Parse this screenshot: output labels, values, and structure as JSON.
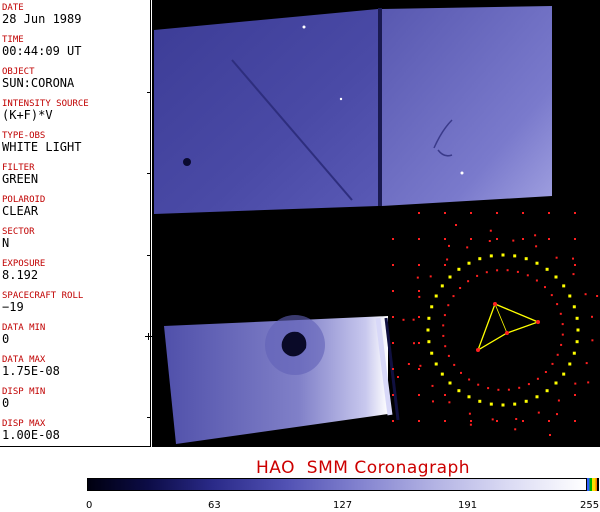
{
  "sidebar": {
    "fields": [
      {
        "label": "DATE",
        "value": "28 Jun 1989"
      },
      {
        "label": "TIME",
        "value": "00:44:09 UT"
      },
      {
        "label": "OBJECT",
        "value": "SUN:CORONA"
      },
      {
        "label": "INTENSITY SOURCE",
        "value": "(K+F)*V"
      },
      {
        "label": "TYPE-OBS",
        "value": "WHITE LIGHT"
      },
      {
        "label": "FILTER",
        "value": "GREEN"
      },
      {
        "label": "POLAROID",
        "value": "CLEAR"
      },
      {
        "label": "SECTOR",
        "value": "N"
      },
      {
        "label": "EXPOSURE",
        "value": "8.192"
      },
      {
        "label": "SPACECRAFT ROLL",
        "value": "−19"
      },
      {
        "label": "DATA MIN",
        "value": "0"
      },
      {
        "label": "DATA MAX",
        "value": "1.75E-08"
      },
      {
        "label": "DISP MIN",
        "value": "0"
      },
      {
        "label": "DISP MAX",
        "value": "1.00E-08"
      }
    ]
  },
  "title": "HAO  SMM Coronagraph",
  "colorbar": {
    "ticks": [
      "0",
      "63",
      "127",
      "191",
      "255"
    ]
  },
  "colors": {
    "label_red": "#c00000",
    "title_red": "#cc0000",
    "overlay_yellow": "#ffff00",
    "overlay_red": "#ff2020"
  }
}
